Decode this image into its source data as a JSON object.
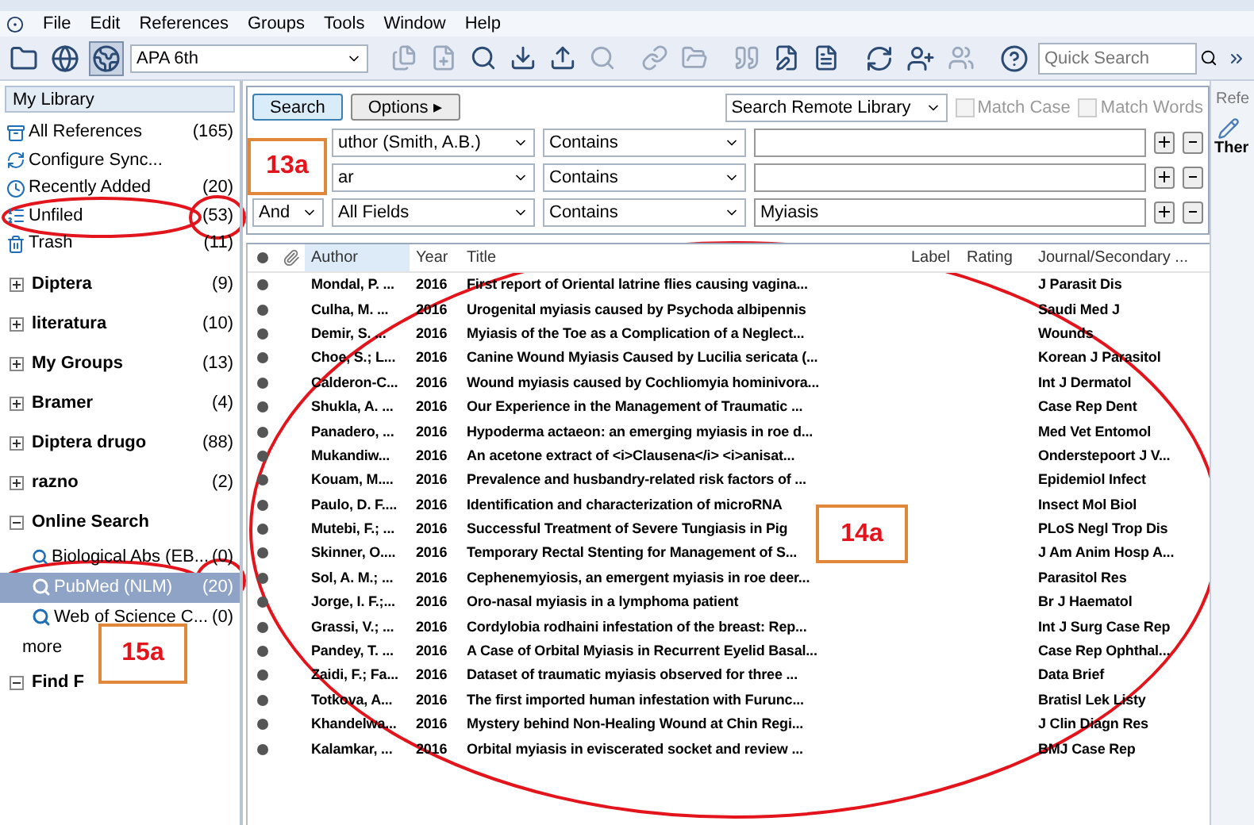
{
  "menu": [
    "File",
    "Edit",
    "References",
    "Groups",
    "Tools",
    "Window",
    "Help"
  ],
  "toolbar": {
    "style": "APA 6th",
    "quick_search": {
      "placeholder": "Quick Search"
    }
  },
  "sidebar": {
    "header": "My Library",
    "library": [
      {
        "label": "All References",
        "count": "(165)",
        "selected": false
      },
      {
        "label": "Configure Sync...",
        "selected": false
      },
      {
        "label": "Recently Added",
        "count": "(20)",
        "selected": false
      },
      {
        "label": "Unfiled",
        "count": "(53)",
        "selected": false
      },
      {
        "label": "Trash",
        "count": "(11)",
        "selected": false
      }
    ],
    "groups": [
      {
        "label": "Diptera",
        "count": "(9)",
        "expanded": false
      },
      {
        "label": "literatura",
        "count": "(10)",
        "expanded": false
      },
      {
        "label": "My Groups",
        "count": "(13)",
        "expanded": false
      },
      {
        "label": "Bramer",
        "count": "(4)",
        "expanded": false
      },
      {
        "label": "Diptera drugo",
        "count": "(88)",
        "expanded": false
      },
      {
        "label": "razno",
        "count": "(2)",
        "expanded": false
      },
      {
        "label": "Online Search",
        "expanded": true,
        "children": [
          {
            "label": "Biological Abs (EB...",
            "count": "(0)",
            "selected": false
          },
          {
            "label": "PubMed (NLM)",
            "count": "(20)",
            "selected": true
          },
          {
            "label": "Web of Science C...",
            "count": "(0)",
            "selected": false
          },
          {
            "label": "more",
            "selected": false
          }
        ]
      },
      {
        "label": "Find F",
        "expanded": true
      }
    ]
  },
  "search": {
    "search_button": "Search",
    "options_button": "Options",
    "options_arrow": "▸",
    "scope": "Search Remote Library",
    "match_case": {
      "label": "Match Case",
      "checked": false,
      "disabled": true
    },
    "match_words": {
      "label": "Match Words",
      "checked": false,
      "disabled": true
    },
    "rows": [
      {
        "field": "uthor (Smith, A.B.)",
        "operator": "Contains",
        "value": ""
      },
      {
        "field": "ar",
        "operator": "Contains",
        "value": ""
      },
      {
        "connector": "And",
        "field": "All Fields",
        "operator": "Contains",
        "value": "Myiasis"
      }
    ]
  },
  "table": {
    "columns": [
      "Author",
      "Year",
      "Title",
      "Label",
      "Rating",
      "Journal/Secondary ..."
    ],
    "rows": [
      {
        "unread": true,
        "author": "Mondal, P. ...",
        "year": "2016",
        "title": "First report of Oriental latrine flies causing vagina...",
        "journal": "J Parasit Dis"
      },
      {
        "unread": true,
        "author": "Culha, M. ...",
        "year": "2016",
        "title": "Urogenital myiasis caused by Psychoda albipennis",
        "journal": "Saudi Med J"
      },
      {
        "unread": true,
        "author": "Demir, S. ...",
        "year": "2016",
        "title": "Myiasis of the Toe as a Complication of a Neglect...",
        "journal": "Wounds"
      },
      {
        "unread": true,
        "author": "Choe, S.; L...",
        "year": "2016",
        "title": "Canine Wound Myiasis Caused by Lucilia sericata (...",
        "journal": "Korean J Parasitol"
      },
      {
        "unread": true,
        "author": "Calderon-C...",
        "year": "2016",
        "title": "Wound myiasis caused by Cochliomyia hominivora...",
        "journal": "Int J Dermatol"
      },
      {
        "unread": true,
        "author": "Shukla, A. ...",
        "year": "2016",
        "title": "Our Experience in the Management of Traumatic ...",
        "journal": "Case Rep Dent"
      },
      {
        "unread": true,
        "author": "Panadero, ...",
        "year": "2016",
        "title": "Hypoderma actaeon: an emerging myiasis in roe d...",
        "journal": "Med Vet Entomol"
      },
      {
        "unread": true,
        "author": "Mukandiw...",
        "year": "2016",
        "title": "An acetone extract of <i>Clausena</i> <i>anisat...",
        "journal": "Onderstepoort J V..."
      },
      {
        "unread": true,
        "author": "Kouam, M....",
        "year": "2016",
        "title": "Prevalence and husbandry-related risk factors of ...",
        "journal": "Epidemiol Infect"
      },
      {
        "unread": true,
        "author": "Paulo, D. F....",
        "year": "2016",
        "title": "Identification and characterization of microRNA",
        "journal": "Insect Mol Biol"
      },
      {
        "unread": true,
        "author": "Mutebi, F.; ...",
        "year": "2016",
        "title": "Successful Treatment of Severe Tungiasis in Pig",
        "journal": "PLoS Negl Trop Dis"
      },
      {
        "unread": true,
        "author": "Skinner, O....",
        "year": "2016",
        "title": "Temporary Rectal Stenting for Management of S...",
        "journal": "J Am Anim Hosp A..."
      },
      {
        "unread": true,
        "author": "Sol, A. M.; ...",
        "year": "2016",
        "title": "Cephenemyiosis, an emergent myiasis in roe deer...",
        "journal": "Parasitol Res"
      },
      {
        "unread": true,
        "author": "Jorge, I. F.;...",
        "year": "2016",
        "title": "Oro-nasal myiasis in a lymphoma patient",
        "journal": "Br J Haematol"
      },
      {
        "unread": true,
        "author": "Grassi, V.; ...",
        "year": "2016",
        "title": "Cordylobia rodhaini infestation of the breast: Rep...",
        "journal": "Int J Surg Case Rep"
      },
      {
        "unread": true,
        "author": "Pandey, T. ...",
        "year": "2016",
        "title": "A Case of Orbital Myiasis in Recurrent Eyelid Basal...",
        "journal": "Case Rep Ophthal..."
      },
      {
        "unread": true,
        "author": "Zaidi, F.; Fa...",
        "year": "2016",
        "title": "Dataset of traumatic myiasis observed for three ...",
        "journal": "Data Brief"
      },
      {
        "unread": true,
        "author": "Totkova, A...",
        "year": "2016",
        "title": "The first imported human infestation with Furunc...",
        "journal": "Bratisl Lek Listy"
      },
      {
        "unread": true,
        "author": "Khandelwa...",
        "year": "2016",
        "title": "Mystery behind Non-Healing Wound at Chin Regi...",
        "journal": "J Clin Diagn Res"
      },
      {
        "unread": true,
        "author": "Kalamkar, ...",
        "year": "2016",
        "title": "Orbital myiasis in eviscerated socket and review ...",
        "journal": "BMJ Case Rep"
      }
    ]
  },
  "right_panel": {
    "tab": "Refe",
    "text": "Ther"
  },
  "annotations": [
    {
      "label": "13a"
    },
    {
      "label": "14a"
    },
    {
      "label": "15a"
    }
  ]
}
